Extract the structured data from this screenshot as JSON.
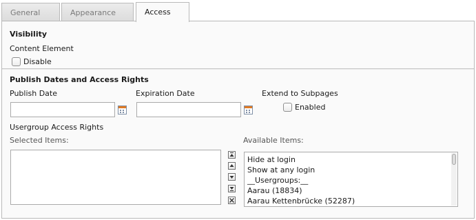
{
  "tabs": [
    {
      "label": "General"
    },
    {
      "label": "Appearance"
    },
    {
      "label": "Access"
    }
  ],
  "visibility": {
    "heading": "Visibility",
    "field_label": "Content Element",
    "disable_label": "Disable",
    "disable_checked": false
  },
  "publish": {
    "heading": "Publish Dates and Access Rights",
    "publish_date_label": "Publish Date",
    "publish_date_value": "",
    "expiration_date_label": "Expiration Date",
    "expiration_date_value": "",
    "extend_label": "Extend to Subpages",
    "enabled_label": "Enabled",
    "enabled_checked": false
  },
  "usergroup": {
    "label": "Usergroup Access Rights",
    "selected_label": "Selected Items:",
    "available_label": "Available Items:",
    "selected_items": [],
    "available_items": [
      "Hide at login",
      "Show at any login",
      "__Usergroups:__",
      "Aarau (18834)",
      "Aarau Kettenbrücke (52287)"
    ]
  },
  "icons": {
    "calendar": "calendar-icon",
    "move_top": "move-to-top-icon",
    "move_up": "move-up-icon",
    "move_down": "move-down-icon",
    "move_bottom": "move-to-bottom-icon",
    "remove": "remove-icon"
  },
  "colors": {
    "calendar_accent": "#e07a24",
    "panel_background": "#fafafa",
    "border": "#b9b9b9"
  }
}
